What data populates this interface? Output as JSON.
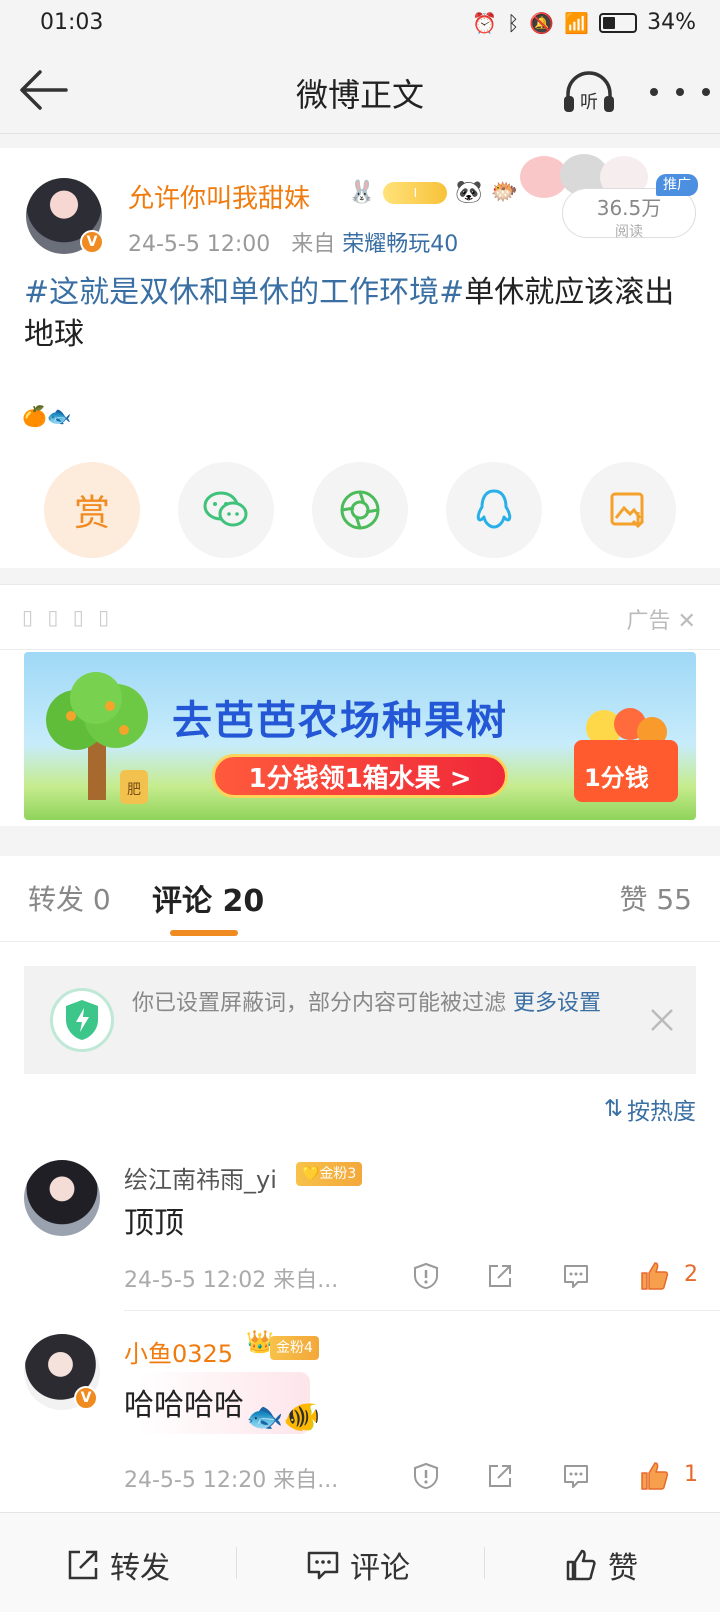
{
  "status_bar": {
    "time": "01:03",
    "battery": "34%"
  },
  "nav": {
    "title": "微博正文",
    "listen_label": "听"
  },
  "post": {
    "author": "允许你叫我甜妹",
    "time": "24-5-5 12:00",
    "from_label": "来自",
    "source": "荣耀畅玩40",
    "reads_count": "36.5万",
    "reads_label": "阅读",
    "promo_tag": "推广",
    "topic": "#这就是双休和单休的工作环境#",
    "text_rest": "单休就应该滚出地球",
    "emojis": "🍊🐟",
    "reward_label": "赏"
  },
  "ad": {
    "label": "广告",
    "title": "去芭芭农场种果树",
    "cta": "1分钱领1箱水果 >",
    "basket_text": "1分钱",
    "tree_tag": "肥"
  },
  "tabs": {
    "repost": "转发 0",
    "comments": "评论 20",
    "likes": "赞 55"
  },
  "filter_notice": {
    "text": "你已设置屏蔽词，部分内容可能被过滤 ",
    "link": "更多设置"
  },
  "sort": {
    "label": "按热度"
  },
  "comments": [
    {
      "user": "绘江南祎雨_yi",
      "badge": "金粉3",
      "text": "顶顶",
      "meta": "24-5-5 12:02  来自...",
      "likes": "2"
    },
    {
      "user": "小鱼0325",
      "badge": "金粉4",
      "text": "哈哈哈哈",
      "meta": "24-5-5 12:20  来自...",
      "likes": "1"
    }
  ],
  "bottom_bar": {
    "repost": "转发",
    "comment": "评论",
    "like": "赞"
  },
  "colors": {
    "accent": "#f08b21",
    "link": "#3a6fa3",
    "name_orange": "#f07b0e"
  }
}
